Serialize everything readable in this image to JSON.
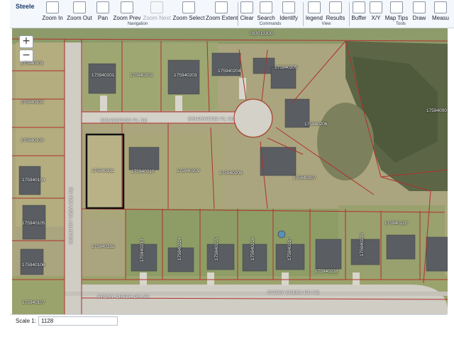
{
  "app": {
    "title": "Steele"
  },
  "toolbar": {
    "navigation": {
      "label": "Navigation",
      "buttons": [
        {
          "label": "Zoom In",
          "enabled": true
        },
        {
          "label": "Zoom Out",
          "enabled": true
        },
        {
          "label": "Pan",
          "enabled": true
        },
        {
          "label": "Zoom Prev",
          "enabled": true
        },
        {
          "label": "Zoom Next",
          "enabled": false
        },
        {
          "label": "Zoom Select",
          "enabled": true
        },
        {
          "label": "Zoom Extent",
          "enabled": true
        }
      ]
    },
    "commands": {
      "label": "Commands",
      "buttons": [
        {
          "label": "Clear",
          "enabled": true
        },
        {
          "label": "Search",
          "enabled": true
        },
        {
          "label": "Identify",
          "enabled": true
        }
      ]
    },
    "view": {
      "label": "View",
      "buttons": [
        {
          "label": "legend",
          "enabled": true
        },
        {
          "label": "Results",
          "enabled": true
        }
      ]
    },
    "tools": {
      "label": "Tools",
      "buttons": [
        {
          "label": "Buffer",
          "enabled": true
        },
        {
          "label": "X/Y",
          "enabled": true
        },
        {
          "label": "Map Tips",
          "enabled": true
        },
        {
          "label": "Draw",
          "enabled": true
        },
        {
          "label": "Measu",
          "enabled": true
        }
      ]
    }
  },
  "map": {
    "zoom_in_label": "+",
    "zoom_out_label": "−",
    "streets": {
      "briarwood_left": "BRIARWOOD PL NE",
      "briarwood_right": "BRIARWOOD PL NE",
      "stony_left": "STONY CREEK DR NE",
      "stony_right": "STONY CREEK DR NE",
      "country_view": "COUNTRY VIEW AVE NE"
    },
    "parcels": {
      "p_top": "083013300",
      "p01": "175940101",
      "p02": "175940102",
      "p03": "175940103",
      "p04": "175940104",
      "p05": "175940105",
      "p06": "175940106",
      "p07": "175940107",
      "p201": "175940201",
      "p202": "175940202",
      "p203": "175940203",
      "p204": "175940204",
      "p205": "175940205",
      "p206": "175940206",
      "p207": "175940207",
      "p208": "175940208",
      "p209": "175940209",
      "p210": "175940210",
      "p211": "175940211",
      "p212": "175940212",
      "p213": "175940213",
      "p214": "175940214",
      "p215": "175940215",
      "p216": "175940216",
      "p217": "175940217",
      "p218": "175940218",
      "p219": "175940219",
      "p220": "175940220",
      "p_right": "17594000"
    }
  },
  "status": {
    "scale_label": "Scale 1:",
    "scale_value": "1128"
  }
}
